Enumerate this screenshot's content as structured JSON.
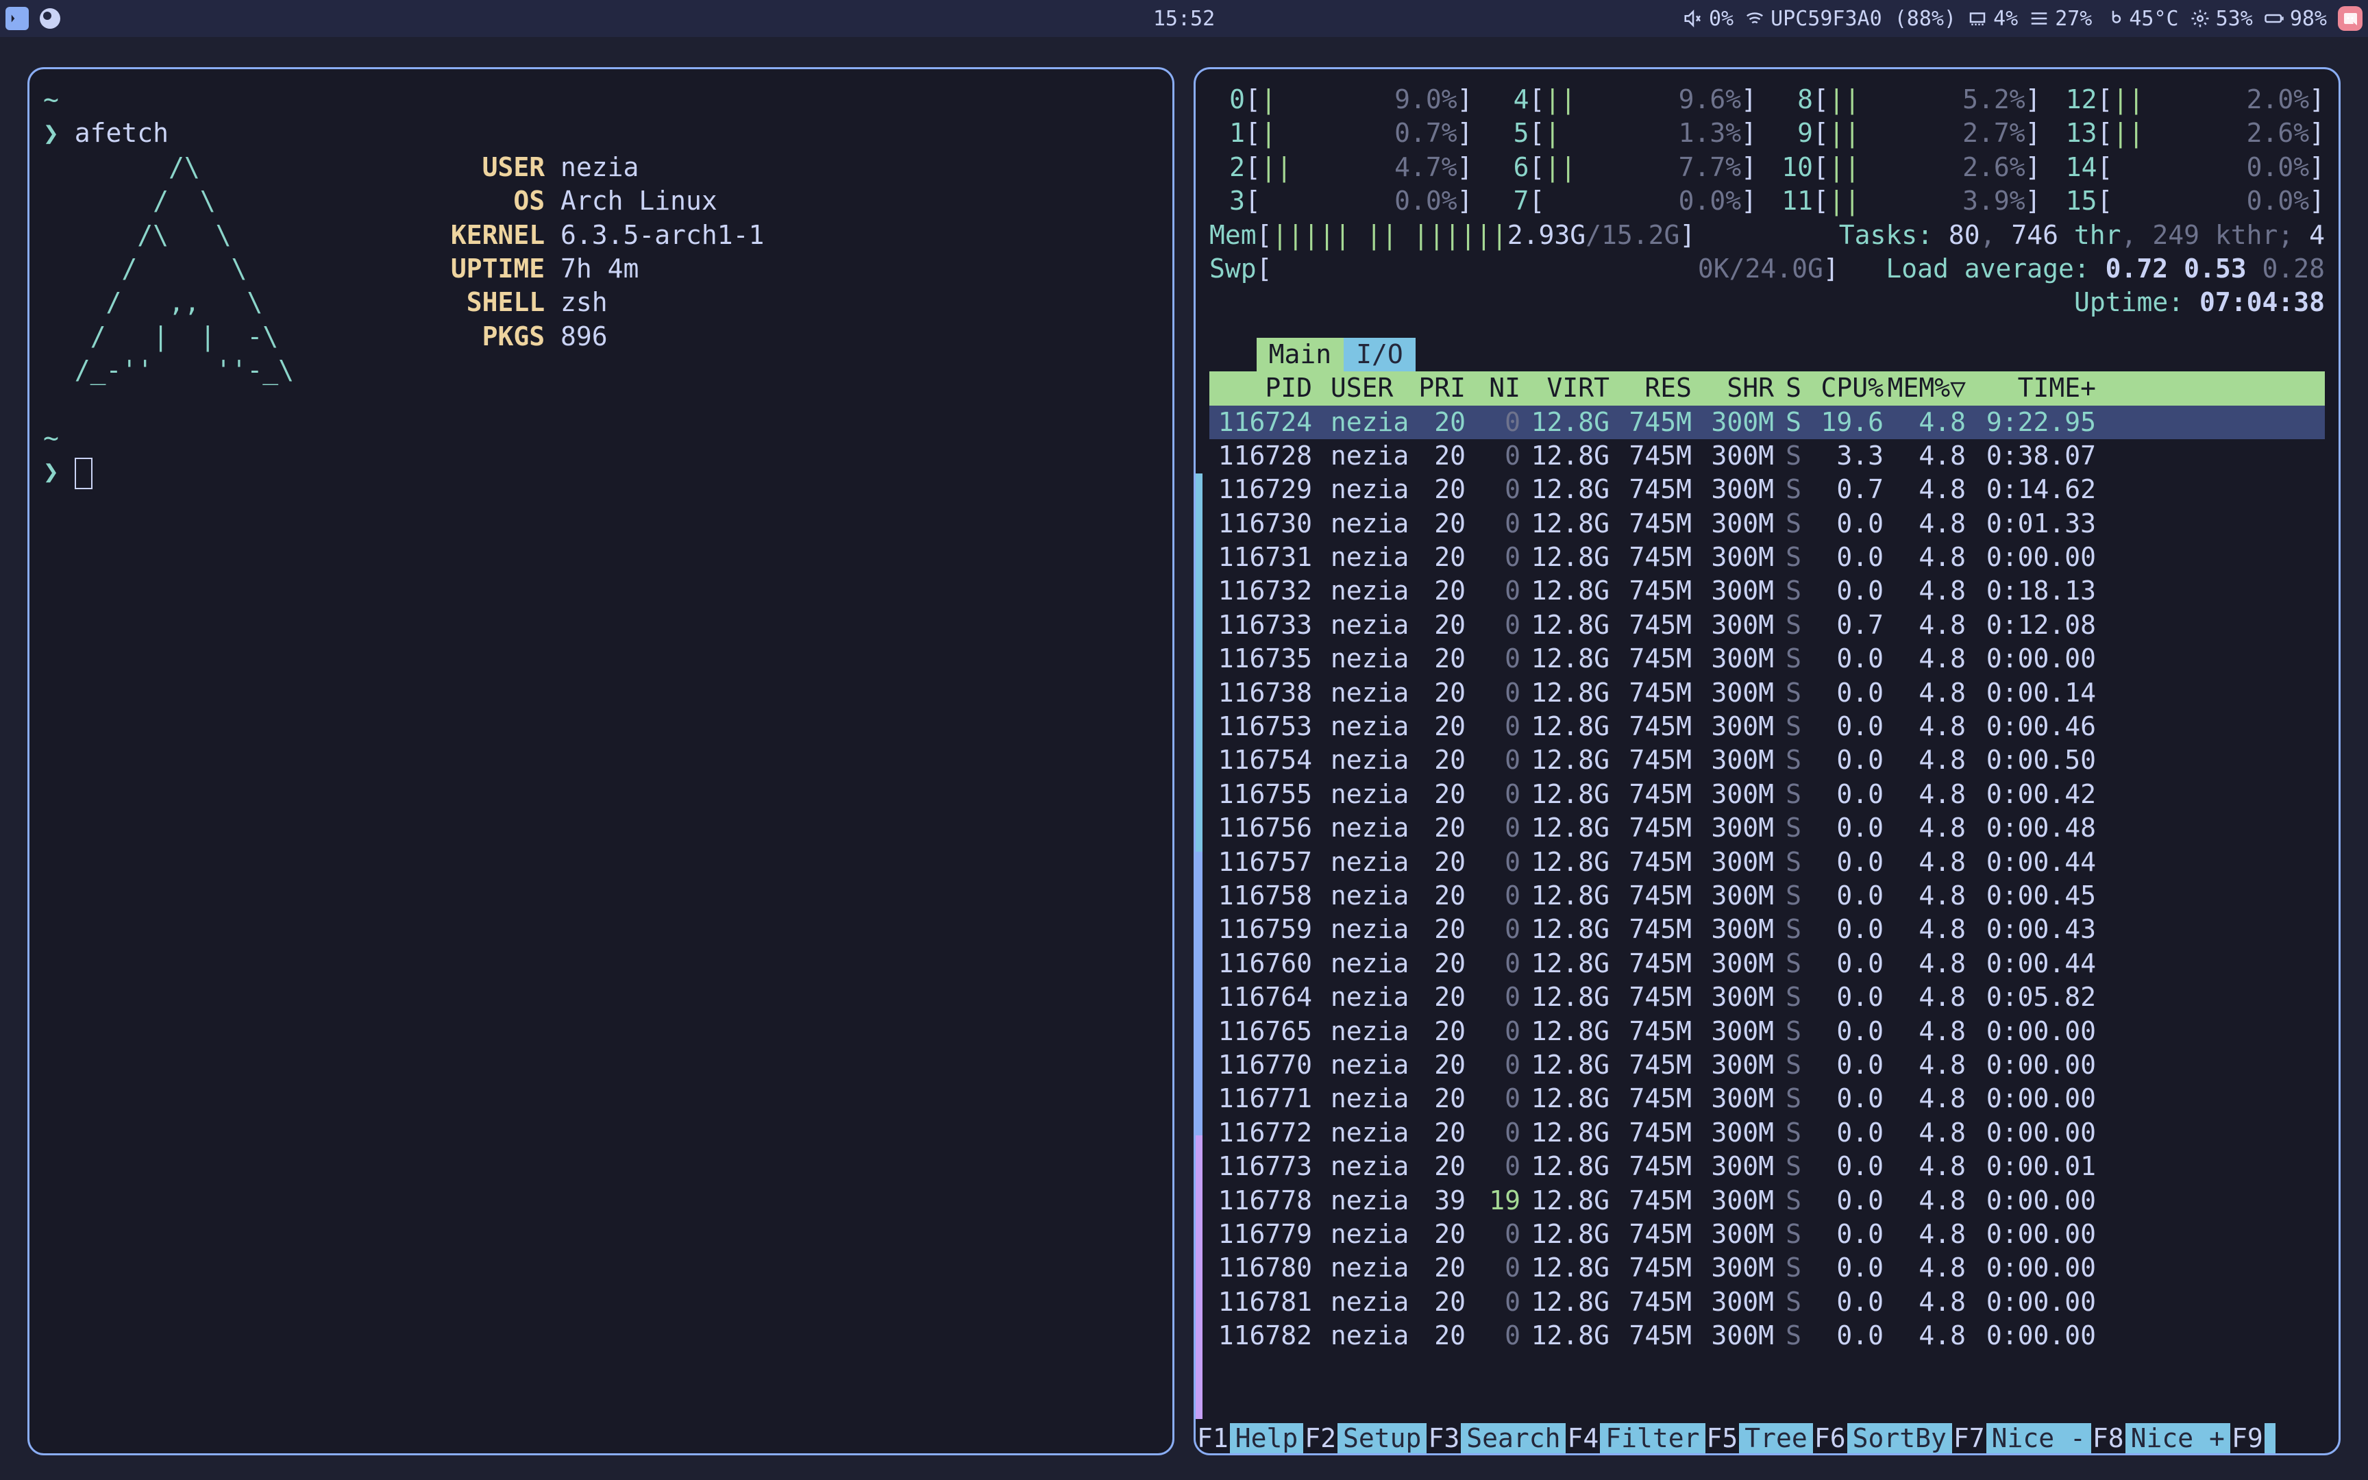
{
  "topbar": {
    "clock": "15:52",
    "volume_pct": "0%",
    "wifi": "UPC59F3A0 (88%)",
    "ram_icon_pct": "4%",
    "hdd_pct": "27%",
    "temp": "45°C",
    "cpu_usage": "53%",
    "battery": "98%"
  },
  "left": {
    "prompt_sym": "❯",
    "cmd": "afetch",
    "ascii": [
      "        /\\",
      "       /  \\",
      "      /\\   \\",
      "     /      \\",
      "    /   ,,   \\",
      "   /   |  |  -\\",
      "  /_-''    ''-_\\"
    ],
    "fields": [
      {
        "label": "USER",
        "value": "nezia"
      },
      {
        "label": "OS",
        "value": "Arch Linux"
      },
      {
        "label": "KERNEL",
        "value": "6.3.5-arch1-1"
      },
      {
        "label": "UPTIME",
        "value": "7h 4m"
      },
      {
        "label": "SHELL",
        "value": "zsh"
      },
      {
        "label": "PKGS",
        "value": "896"
      }
    ],
    "prompt2": "❯"
  },
  "htop": {
    "cpus": [
      {
        "n": "0",
        "bar": "|",
        "pct": "9.0%"
      },
      {
        "n": "4",
        "bar": "||",
        "pct": "9.6%"
      },
      {
        "n": "8",
        "bar": "||",
        "pct": "5.2%"
      },
      {
        "n": "12",
        "bar": "||",
        "pct": "2.0%"
      },
      {
        "n": "1",
        "bar": "|",
        "pct": "0.7%"
      },
      {
        "n": "5",
        "bar": "|",
        "pct": "1.3%"
      },
      {
        "n": "9",
        "bar": "||",
        "pct": "2.7%"
      },
      {
        "n": "13",
        "bar": "||",
        "pct": "2.6%"
      },
      {
        "n": "2",
        "bar": "||",
        "pct": "4.7%"
      },
      {
        "n": "6",
        "bar": "||",
        "pct": "7.7%"
      },
      {
        "n": "10",
        "bar": "||",
        "pct": "2.6%"
      },
      {
        "n": "14",
        "bar": "",
        "pct": "0.0%"
      },
      {
        "n": "3",
        "bar": "",
        "pct": "0.0%"
      },
      {
        "n": "7",
        "bar": "",
        "pct": "0.0%"
      },
      {
        "n": "11",
        "bar": "||",
        "pct": "3.9%"
      },
      {
        "n": "15",
        "bar": "",
        "pct": "0.0%"
      }
    ],
    "mem": {
      "label": "Mem",
      "bar": "||||| || ||||||",
      "used": "2.93G",
      "total": "15.2G"
    },
    "swp": {
      "label": "Swp",
      "bar": "",
      "used": "0K",
      "total": "24.0G"
    },
    "tasks": {
      "label": "Tasks:",
      "procs": "80",
      "thr": "746",
      "thr_label": "thr",
      "kthr": "249",
      "kthr_label": "kthr",
      "running": "4"
    },
    "load": {
      "label": "Load average:",
      "l1": "0.72",
      "l2": "0.53",
      "l3": "0.28"
    },
    "uptime": {
      "label": "Uptime:",
      "value": "07:04:38"
    },
    "tabs": {
      "main": "Main",
      "io": "I/O"
    },
    "header": [
      "PID",
      "USER",
      "PRI",
      "NI",
      "VIRT",
      "RES",
      "SHR",
      "S",
      "CPU%",
      "MEM%▽",
      "TIME+"
    ],
    "procs": [
      {
        "pid": "116724",
        "user": "nezia",
        "pri": "20",
        "ni": "0",
        "virt": "12.8G",
        "res": "745M",
        "shr": "300M",
        "s": "S",
        "cpu": "19.6",
        "mem": "4.8",
        "time": "9:22.95",
        "sel": true
      },
      {
        "pid": "116728",
        "user": "nezia",
        "pri": "20",
        "ni": "0",
        "virt": "12.8G",
        "res": "745M",
        "shr": "300M",
        "s": "S",
        "cpu": "3.3",
        "mem": "4.8",
        "time": "0:38.07"
      },
      {
        "pid": "116729",
        "user": "nezia",
        "pri": "20",
        "ni": "0",
        "virt": "12.8G",
        "res": "745M",
        "shr": "300M",
        "s": "S",
        "cpu": "0.7",
        "mem": "4.8",
        "time": "0:14.62"
      },
      {
        "pid": "116730",
        "user": "nezia",
        "pri": "20",
        "ni": "0",
        "virt": "12.8G",
        "res": "745M",
        "shr": "300M",
        "s": "S",
        "cpu": "0.0",
        "mem": "4.8",
        "time": "0:01.33"
      },
      {
        "pid": "116731",
        "user": "nezia",
        "pri": "20",
        "ni": "0",
        "virt": "12.8G",
        "res": "745M",
        "shr": "300M",
        "s": "S",
        "cpu": "0.0",
        "mem": "4.8",
        "time": "0:00.00"
      },
      {
        "pid": "116732",
        "user": "nezia",
        "pri": "20",
        "ni": "0",
        "virt": "12.8G",
        "res": "745M",
        "shr": "300M",
        "s": "S",
        "cpu": "0.0",
        "mem": "4.8",
        "time": "0:18.13"
      },
      {
        "pid": "116733",
        "user": "nezia",
        "pri": "20",
        "ni": "0",
        "virt": "12.8G",
        "res": "745M",
        "shr": "300M",
        "s": "S",
        "cpu": "0.7",
        "mem": "4.8",
        "time": "0:12.08"
      },
      {
        "pid": "116735",
        "user": "nezia",
        "pri": "20",
        "ni": "0",
        "virt": "12.8G",
        "res": "745M",
        "shr": "300M",
        "s": "S",
        "cpu": "0.0",
        "mem": "4.8",
        "time": "0:00.00"
      },
      {
        "pid": "116738",
        "user": "nezia",
        "pri": "20",
        "ni": "0",
        "virt": "12.8G",
        "res": "745M",
        "shr": "300M",
        "s": "S",
        "cpu": "0.0",
        "mem": "4.8",
        "time": "0:00.14"
      },
      {
        "pid": "116753",
        "user": "nezia",
        "pri": "20",
        "ni": "0",
        "virt": "12.8G",
        "res": "745M",
        "shr": "300M",
        "s": "S",
        "cpu": "0.0",
        "mem": "4.8",
        "time": "0:00.46"
      },
      {
        "pid": "116754",
        "user": "nezia",
        "pri": "20",
        "ni": "0",
        "virt": "12.8G",
        "res": "745M",
        "shr": "300M",
        "s": "S",
        "cpu": "0.0",
        "mem": "4.8",
        "time": "0:00.50"
      },
      {
        "pid": "116755",
        "user": "nezia",
        "pri": "20",
        "ni": "0",
        "virt": "12.8G",
        "res": "745M",
        "shr": "300M",
        "s": "S",
        "cpu": "0.0",
        "mem": "4.8",
        "time": "0:00.42"
      },
      {
        "pid": "116756",
        "user": "nezia",
        "pri": "20",
        "ni": "0",
        "virt": "12.8G",
        "res": "745M",
        "shr": "300M",
        "s": "S",
        "cpu": "0.0",
        "mem": "4.8",
        "time": "0:00.48"
      },
      {
        "pid": "116757",
        "user": "nezia",
        "pri": "20",
        "ni": "0",
        "virt": "12.8G",
        "res": "745M",
        "shr": "300M",
        "s": "S",
        "cpu": "0.0",
        "mem": "4.8",
        "time": "0:00.44"
      },
      {
        "pid": "116758",
        "user": "nezia",
        "pri": "20",
        "ni": "0",
        "virt": "12.8G",
        "res": "745M",
        "shr": "300M",
        "s": "S",
        "cpu": "0.0",
        "mem": "4.8",
        "time": "0:00.45"
      },
      {
        "pid": "116759",
        "user": "nezia",
        "pri": "20",
        "ni": "0",
        "virt": "12.8G",
        "res": "745M",
        "shr": "300M",
        "s": "S",
        "cpu": "0.0",
        "mem": "4.8",
        "time": "0:00.43"
      },
      {
        "pid": "116760",
        "user": "nezia",
        "pri": "20",
        "ni": "0",
        "virt": "12.8G",
        "res": "745M",
        "shr": "300M",
        "s": "S",
        "cpu": "0.0",
        "mem": "4.8",
        "time": "0:00.44"
      },
      {
        "pid": "116764",
        "user": "nezia",
        "pri": "20",
        "ni": "0",
        "virt": "12.8G",
        "res": "745M",
        "shr": "300M",
        "s": "S",
        "cpu": "0.0",
        "mem": "4.8",
        "time": "0:05.82"
      },
      {
        "pid": "116765",
        "user": "nezia",
        "pri": "20",
        "ni": "0",
        "virt": "12.8G",
        "res": "745M",
        "shr": "300M",
        "s": "S",
        "cpu": "0.0",
        "mem": "4.8",
        "time": "0:00.00"
      },
      {
        "pid": "116770",
        "user": "nezia",
        "pri": "20",
        "ni": "0",
        "virt": "12.8G",
        "res": "745M",
        "shr": "300M",
        "s": "S",
        "cpu": "0.0",
        "mem": "4.8",
        "time": "0:00.00"
      },
      {
        "pid": "116771",
        "user": "nezia",
        "pri": "20",
        "ni": "0",
        "virt": "12.8G",
        "res": "745M",
        "shr": "300M",
        "s": "S",
        "cpu": "0.0",
        "mem": "4.8",
        "time": "0:00.00"
      },
      {
        "pid": "116772",
        "user": "nezia",
        "pri": "20",
        "ni": "0",
        "virt": "12.8G",
        "res": "745M",
        "shr": "300M",
        "s": "S",
        "cpu": "0.0",
        "mem": "4.8",
        "time": "0:00.00"
      },
      {
        "pid": "116773",
        "user": "nezia",
        "pri": "20",
        "ni": "0",
        "virt": "12.8G",
        "res": "745M",
        "shr": "300M",
        "s": "S",
        "cpu": "0.0",
        "mem": "4.8",
        "time": "0:00.01"
      },
      {
        "pid": "116778",
        "user": "nezia",
        "pri": "39",
        "ni": "19",
        "virt": "12.8G",
        "res": "745M",
        "shr": "300M",
        "s": "S",
        "cpu": "0.0",
        "mem": "4.8",
        "time": "0:00.00"
      },
      {
        "pid": "116779",
        "user": "nezia",
        "pri": "20",
        "ni": "0",
        "virt": "12.8G",
        "res": "745M",
        "shr": "300M",
        "s": "S",
        "cpu": "0.0",
        "mem": "4.8",
        "time": "0:00.00"
      },
      {
        "pid": "116780",
        "user": "nezia",
        "pri": "20",
        "ni": "0",
        "virt": "12.8G",
        "res": "745M",
        "shr": "300M",
        "s": "S",
        "cpu": "0.0",
        "mem": "4.8",
        "time": "0:00.00"
      },
      {
        "pid": "116781",
        "user": "nezia",
        "pri": "20",
        "ni": "0",
        "virt": "12.8G",
        "res": "745M",
        "shr": "300M",
        "s": "S",
        "cpu": "0.0",
        "mem": "4.8",
        "time": "0:00.00"
      },
      {
        "pid": "116782",
        "user": "nezia",
        "pri": "20",
        "ni": "0",
        "virt": "12.8G",
        "res": "745M",
        "shr": "300M",
        "s": "S",
        "cpu": "0.0",
        "mem": "4.8",
        "time": "0:00.00"
      }
    ],
    "fkeys": [
      {
        "k": "F1",
        "l": "Help  "
      },
      {
        "k": "F2",
        "l": "Setup "
      },
      {
        "k": "F3",
        "l": "Search"
      },
      {
        "k": "F4",
        "l": "Filter"
      },
      {
        "k": "F5",
        "l": "Tree  "
      },
      {
        "k": "F6",
        "l": "SortBy"
      },
      {
        "k": "F7",
        "l": "Nice -"
      },
      {
        "k": "F8",
        "l": "Nice +"
      },
      {
        "k": "F9",
        "l": ""
      }
    ]
  }
}
